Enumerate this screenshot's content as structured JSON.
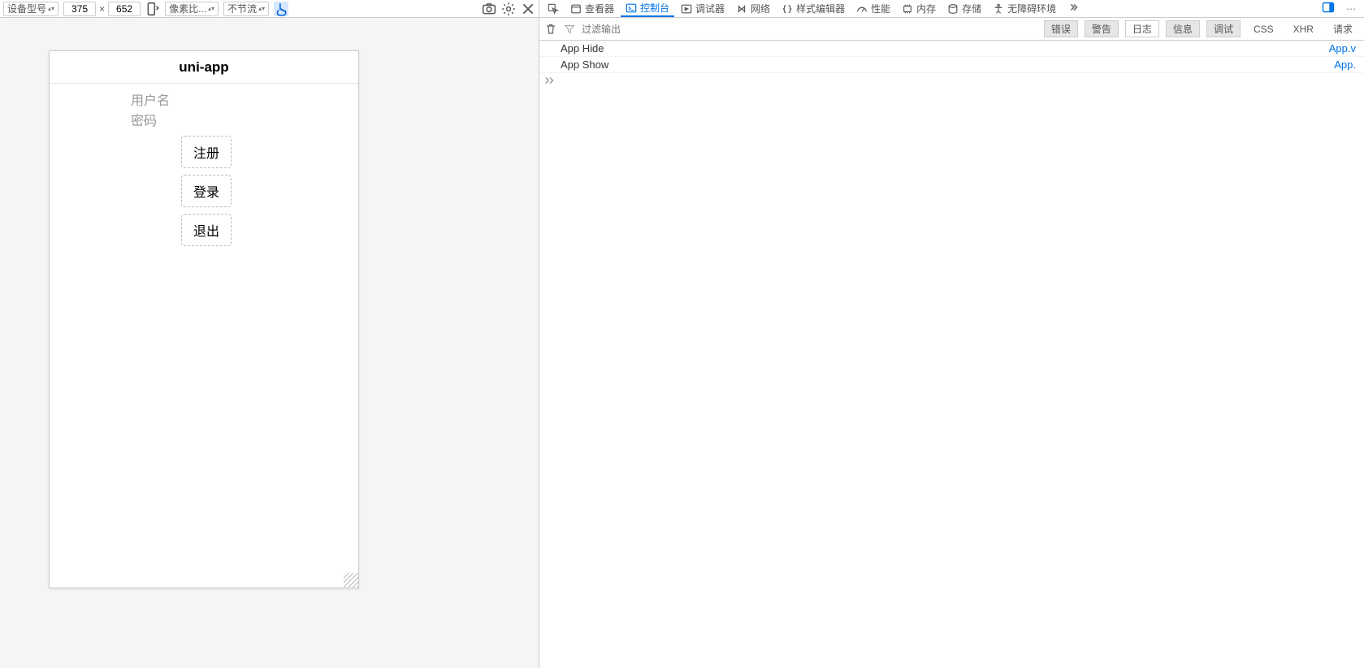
{
  "rdm": {
    "device_model_label": "设备型号",
    "width": "375",
    "height": "652",
    "dpr_label": "像素比...",
    "throttle_label": "不节流",
    "multiply": "×"
  },
  "app": {
    "title": "uni-app",
    "username_placeholder": "用户名",
    "password_placeholder": "密码",
    "btn_register": "注册",
    "btn_login": "登录",
    "btn_logout": "退出"
  },
  "devtools": {
    "tabs": {
      "inspector": "查看器",
      "console": "控制台",
      "debugger": "调试器",
      "network": "网络",
      "style": "样式编辑器",
      "performance": "性能",
      "memory": "内存",
      "storage": "存储",
      "accessibility": "无障碍环境"
    },
    "filter_placeholder": "过滤输出",
    "levels": {
      "error": "错误",
      "warn": "警告",
      "log": "日志",
      "info": "信息",
      "debug": "调试"
    },
    "extra": {
      "css": "CSS",
      "xhr": "XHR",
      "requests": "请求"
    },
    "logs": [
      {
        "msg": "App Hide",
        "src": "App.v"
      },
      {
        "msg": "App Show",
        "src": "App."
      }
    ]
  }
}
